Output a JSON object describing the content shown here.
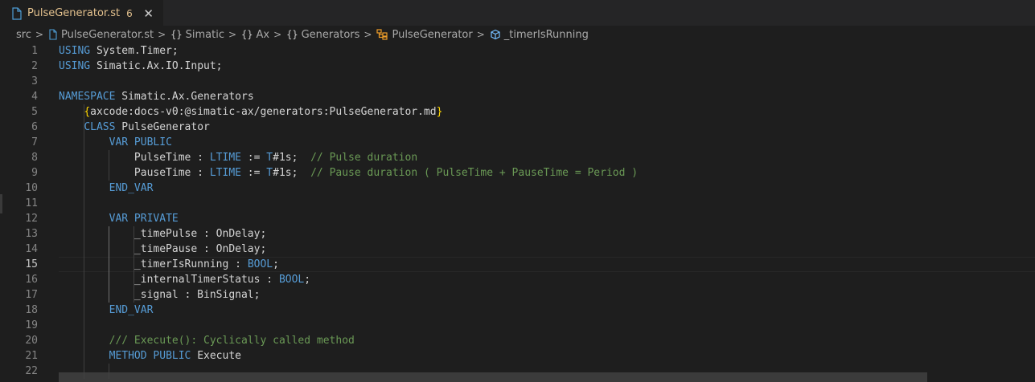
{
  "tab": {
    "title": "PulseGenerator.st",
    "problem_count": "6",
    "close_symbol": "✕",
    "icon": "file-icon"
  },
  "breadcrumb": {
    "items": [
      {
        "label": "src",
        "icon": null
      },
      {
        "label": "PulseGenerator.st",
        "icon": "file-icon"
      },
      {
        "label": "Simatic",
        "icon": "namespace-braces-icon",
        "braces": "{}"
      },
      {
        "label": "Ax",
        "icon": "namespace-braces-icon",
        "braces": "{}"
      },
      {
        "label": "Generators",
        "icon": "namespace-braces-icon",
        "braces": "{}"
      },
      {
        "label": "PulseGenerator",
        "icon": "class-icon"
      },
      {
        "label": "_timerIsRunning",
        "icon": "field-icon"
      }
    ],
    "separator": ">"
  },
  "editor": {
    "current_line": 15,
    "lines": [
      {
        "n": "1",
        "t": [
          [
            "kw",
            "USING"
          ],
          [
            "pl",
            " System.Timer;"
          ]
        ]
      },
      {
        "n": "2",
        "t": [
          [
            "kw",
            "USING"
          ],
          [
            "pl",
            " Simatic.Ax.IO.Input;"
          ]
        ]
      },
      {
        "n": "3",
        "t": []
      },
      {
        "n": "4",
        "t": [
          [
            "kw",
            "NAMESPACE"
          ],
          [
            "pl",
            " Simatic.Ax.Generators"
          ]
        ]
      },
      {
        "n": "5",
        "t": [
          [
            "pl",
            "    "
          ],
          [
            "br",
            "{"
          ],
          [
            "pl",
            "axcode:docs-v0:@simatic-ax/generators:PulseGenerator.md"
          ],
          [
            "br",
            "}"
          ]
        ]
      },
      {
        "n": "6",
        "t": [
          [
            "pl",
            "    "
          ],
          [
            "kw",
            "CLASS"
          ],
          [
            "pl",
            " PulseGenerator"
          ]
        ]
      },
      {
        "n": "7",
        "t": [
          [
            "pl",
            "        "
          ],
          [
            "kw",
            "VAR PUBLIC"
          ]
        ]
      },
      {
        "n": "8",
        "t": [
          [
            "pl",
            "            PulseTime : "
          ],
          [
            "ty",
            "LTIME"
          ],
          [
            "pl",
            " := "
          ],
          [
            "ty",
            "T"
          ],
          [
            "pl",
            "#1s;  "
          ],
          [
            "cm",
            "// Pulse duration"
          ]
        ]
      },
      {
        "n": "9",
        "t": [
          [
            "pl",
            "            PauseTime : "
          ],
          [
            "ty",
            "LTIME"
          ],
          [
            "pl",
            " := "
          ],
          [
            "ty",
            "T"
          ],
          [
            "pl",
            "#1s;  "
          ],
          [
            "cm",
            "// Pause duration ( PulseTime + PauseTime = Period )"
          ]
        ]
      },
      {
        "n": "10",
        "t": [
          [
            "pl",
            "        "
          ],
          [
            "kw",
            "END_VAR"
          ]
        ]
      },
      {
        "n": "11",
        "t": []
      },
      {
        "n": "12",
        "t": [
          [
            "pl",
            "        "
          ],
          [
            "kw",
            "VAR PRIVATE"
          ]
        ]
      },
      {
        "n": "13",
        "t": [
          [
            "pl",
            "            _timePulse : OnDelay;"
          ]
        ]
      },
      {
        "n": "14",
        "t": [
          [
            "pl",
            "            _timePause : OnDelay;"
          ]
        ]
      },
      {
        "n": "15",
        "t": [
          [
            "pl",
            "            _timerIsRunning : "
          ],
          [
            "ty",
            "BOOL"
          ],
          [
            "pl",
            ";"
          ]
        ]
      },
      {
        "n": "16",
        "t": [
          [
            "pl",
            "            _internalTimerStatus : "
          ],
          [
            "ty",
            "BOOL"
          ],
          [
            "pl",
            ";"
          ]
        ]
      },
      {
        "n": "17",
        "t": [
          [
            "pl",
            "            _signal : BinSignal;"
          ]
        ]
      },
      {
        "n": "18",
        "t": [
          [
            "pl",
            "        "
          ],
          [
            "kw",
            "END_VAR"
          ]
        ]
      },
      {
        "n": "19",
        "t": []
      },
      {
        "n": "20",
        "t": [
          [
            "pl",
            "        "
          ],
          [
            "cm",
            "/// Execute(): Cyclically called method"
          ]
        ]
      },
      {
        "n": "21",
        "t": [
          [
            "pl",
            "        "
          ],
          [
            "kw",
            "METHOD PUBLIC"
          ],
          [
            "pl",
            " Execute"
          ]
        ]
      },
      {
        "n": "22",
        "t": []
      }
    ]
  },
  "colors": {
    "background": "#1e1e1e",
    "keyword": "#569cd6",
    "comment": "#6a9955",
    "tab_modified": "#e2c08d",
    "bracket": "#ffd700"
  }
}
